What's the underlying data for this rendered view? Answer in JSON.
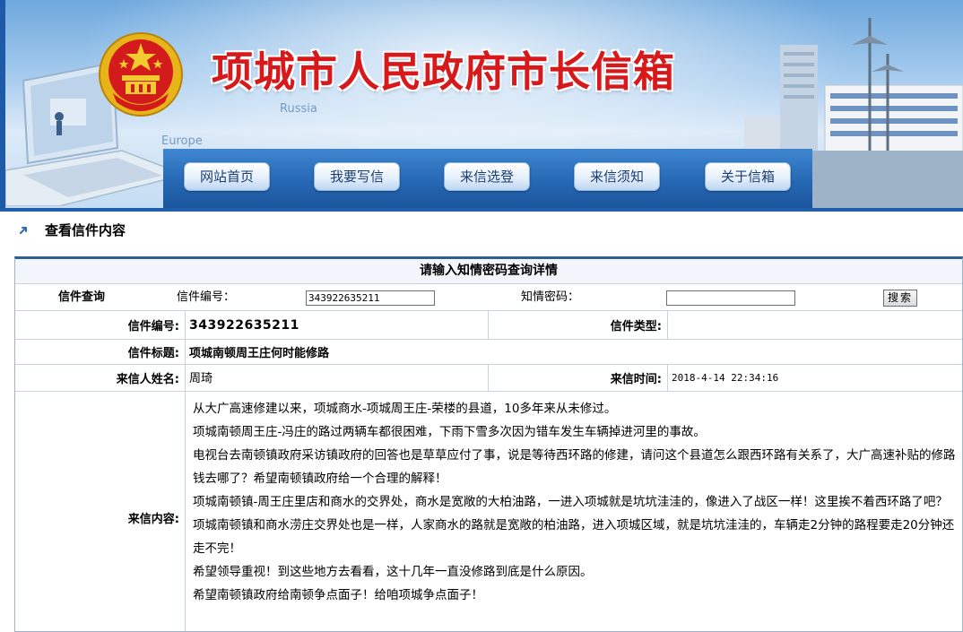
{
  "header": {
    "site_title": "项城市人民政府市长信箱",
    "map_labels": [
      "Russia",
      "Europe"
    ]
  },
  "nav": {
    "items": [
      "网站首页",
      "我要写信",
      "来信选登",
      "来信须知",
      "关于信箱"
    ]
  },
  "section": {
    "title": "查看信件内容"
  },
  "query": {
    "title": "请输入知情密码查询详情",
    "search_label": "信件查询",
    "letter_no_label": "信件编号：",
    "letter_no_value": "343922635211",
    "password_label": "知情密码：",
    "password_value": "",
    "search_button": "搜索"
  },
  "letter": {
    "no_label": "信件编号:",
    "no_value": "343922635211",
    "type_label": "信件类型:",
    "type_value": "",
    "subject_label": "信件标题:",
    "subject_value": "项城南顿周王庄何时能修路",
    "sender_label": "来信人姓名:",
    "sender_value": "周琦",
    "time_label": "来信时间:",
    "time_value": "2018-4-14 22:34:16",
    "content_label": "来信内容:",
    "content_paragraphs": [
      "从大广高速修建以来，项城商水-项城周王庄-荣楼的县道，10多年来从未修过。",
      "项城南顿周王庄-冯庄的路过两辆车都很困难，下雨下雪多次因为错车发生车辆掉进河里的事故。",
      "电视台去南顿镇政府采访镇政府的回答也是草草应付了事，说是等待西环路的修建，请问这个县道怎么跟西环路有关系了，大广高速补贴的修路钱去哪了？希望南顿镇政府给一个合理的解释！",
      "项城南顿镇-周王庄里店和商水的交界处，商水是宽敞的大柏油路，一进入项城就是坑坑洼洼的，像进入了战区一样！这里挨不着西环路了吧？",
      "项城南顿镇和商水涝庄交界处也是一样，人家商水的路就是宽敞的柏油路，进入项城区域，就是坑坑洼洼的，车辆走2分钟的路程要走20分钟还走不完！",
      "希望领导重视！到这些地方去看看，这十几年一直没修路到底是什么原因。",
      "希望南顿镇政府给南顿争点面子！给咱项城争点面子！"
    ]
  },
  "colors": {
    "title_red": "#d7191b",
    "nav_blue": "#2668b4",
    "nav_text": "#1a3d75"
  }
}
